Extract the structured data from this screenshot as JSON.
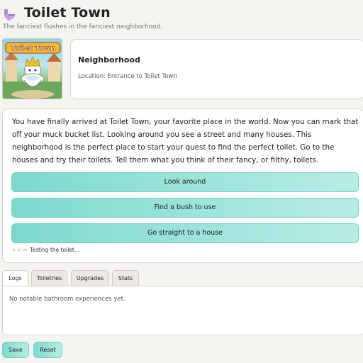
{
  "header": {
    "title": "Toilet Town",
    "subtitle": "The fanciest flushes in the fanciest neighborhood.",
    "icon": "toilet-icon"
  },
  "location": {
    "image_banner": "Toilet Town",
    "name": "Neighborhood",
    "location_line": "Location: Entrance to Toilet Town"
  },
  "story": {
    "text": "You have finally arrived at Toilet Town, your favorite place in the world. Now you can mark that off your muck bucket list. Looking around you see a street and many houses. This neighborhood is the perfect place to start your quest to find the perfect toilet. Go to the houses and try their toilets. Tell them what you think of their fancy, or filthy, toilets.",
    "choices": [
      {
        "label": "Look around"
      },
      {
        "label": "Find a bush to use"
      },
      {
        "label": "Go straight to a house"
      }
    ],
    "status_stars": "★★★",
    "status_text": "Testing the toilet..."
  },
  "tabs": [
    {
      "label": "Logs",
      "active": true
    },
    {
      "label": "Toiletries",
      "active": false
    },
    {
      "label": "Upgrades",
      "active": false
    },
    {
      "label": "Stats",
      "active": false
    }
  ],
  "log": {
    "empty_text": "No notable bathroom experiences yet."
  },
  "footer": {
    "save_label": "Save",
    "reset_label": "Reset"
  },
  "colors": {
    "accent": "#7cd9cc",
    "accent_light": "#b8ede6",
    "accent_border": "#6fcfc2",
    "background": "#f6f4f0",
    "star": "#e6cf8a"
  }
}
